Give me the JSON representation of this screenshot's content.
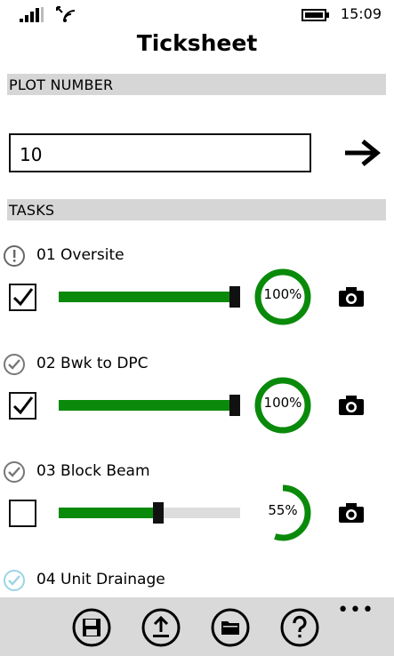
{
  "status_bar": {
    "time": "15:09"
  },
  "page": {
    "title": "Ticksheet"
  },
  "plot": {
    "section_label": "PLOT NUMBER",
    "value": "10"
  },
  "tasks_section": {
    "label": "TASKS"
  },
  "tasks": [
    {
      "name": "01 Oversite",
      "status_icon": "exclamation-circle-icon",
      "checked": true,
      "progress": 100,
      "progress_label": "100%"
    },
    {
      "name": "02 Bwk to DPC",
      "status_icon": "check-circle-icon",
      "checked": true,
      "progress": 100,
      "progress_label": "100%"
    },
    {
      "name": "03 Block Beam",
      "status_icon": "check-circle-icon",
      "checked": false,
      "progress": 55,
      "progress_label": "55%"
    },
    {
      "name": "04 Unit Drainage",
      "status_icon": "check-circle-light-icon"
    }
  ],
  "app_bar": {
    "buttons": [
      "save-icon",
      "upload-icon",
      "folder-icon",
      "help-icon"
    ],
    "more": "•••"
  },
  "colors": {
    "accent": "#0a8a0a",
    "section_bg": "#d6d6d6",
    "app_bar_bg": "#d9d9d9"
  }
}
